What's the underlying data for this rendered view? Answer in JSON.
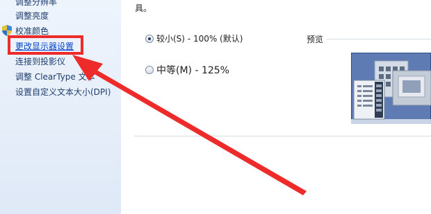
{
  "sidebar": {
    "items": [
      {
        "label": "调整分辨率",
        "active": false
      },
      {
        "label": "调整亮度",
        "active": false
      },
      {
        "label": "校准颜色",
        "active": false,
        "icon": "shield-icon"
      },
      {
        "label": "更改显示器设置",
        "active": true
      },
      {
        "label": "连接到投影仪",
        "active": false
      },
      {
        "label": "调整 ClearType 文本",
        "active": false
      },
      {
        "label": "设置自定义文本大小(DPI)",
        "active": false
      }
    ]
  },
  "main": {
    "truncated_text": "具。",
    "options": [
      {
        "label": "较小(S) - 100% (默认)",
        "checked": true
      },
      {
        "label": "中等(M) - 125%",
        "checked": false
      }
    ],
    "preview_label": "预览"
  },
  "annotation": {
    "color": "#ee2b2b"
  }
}
